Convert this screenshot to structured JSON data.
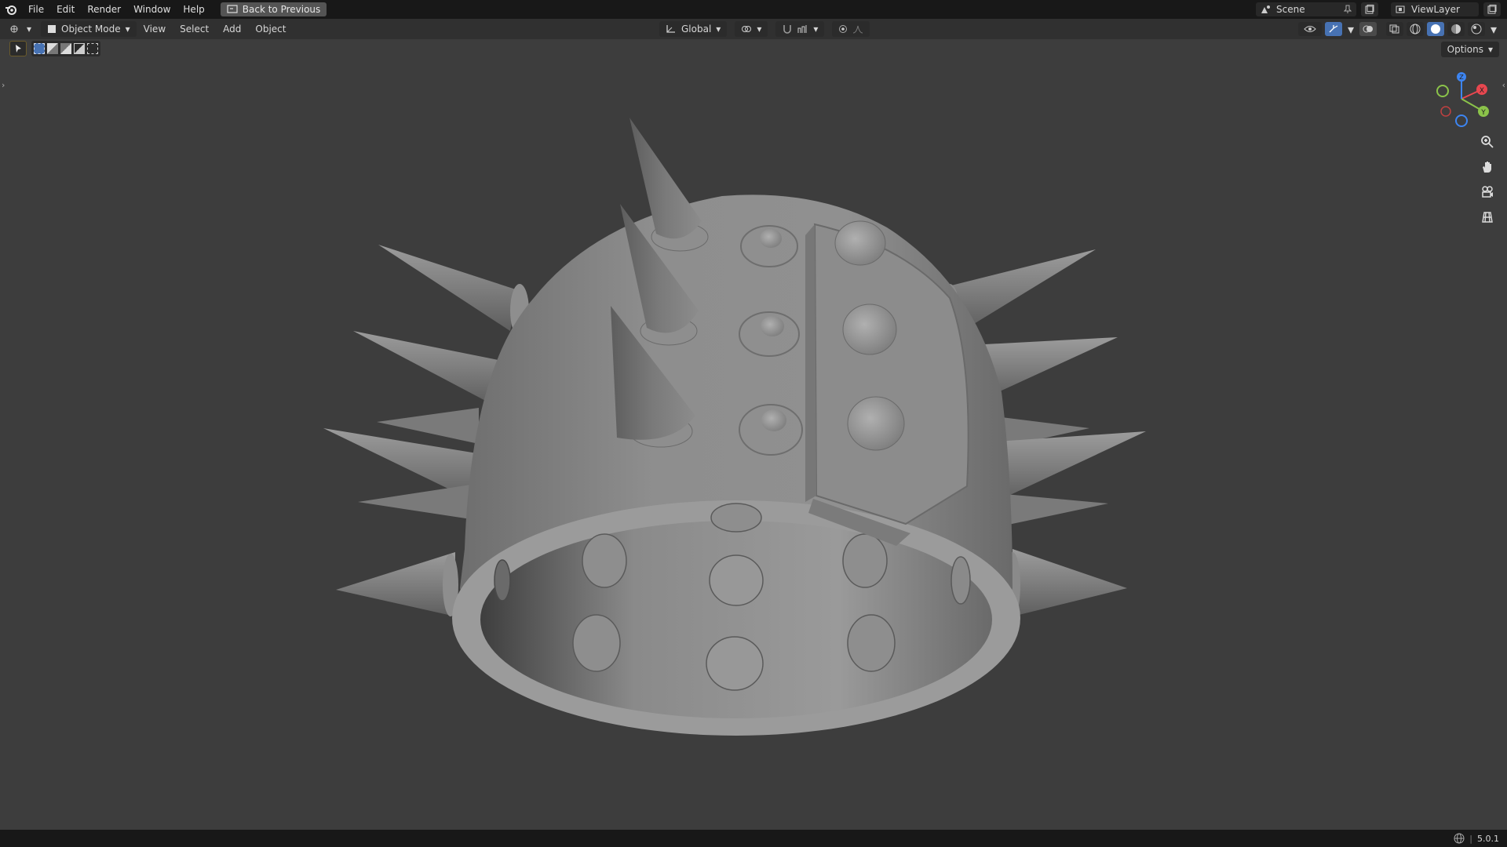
{
  "topbar": {
    "menu": [
      "File",
      "Edit",
      "Render",
      "Window",
      "Help"
    ],
    "back_label": "Back to Previous",
    "scene_name": "Scene",
    "viewlayer_name": "ViewLayer"
  },
  "header": {
    "mode_label": "Object Mode",
    "menus": [
      "View",
      "Select",
      "Add",
      "Object"
    ],
    "transform_orientation": "Global",
    "options_label": "Options"
  },
  "gizmo": {
    "x_label": "X",
    "y_label": "Y",
    "z_label": "Z",
    "x_color": "#e8474f",
    "y_color": "#8bc34a",
    "z_color": "#3d85f2"
  },
  "icons": {
    "app": "blender-logo-icon",
    "back": "back-screen-icon",
    "zoom": "zoom-icon",
    "pan": "pan-hand-icon",
    "camera": "camera-view-icon",
    "ortho": "grid-perspective-icon"
  },
  "status": {
    "version": "5.0.1"
  },
  "colors": {
    "viewport_bg": "#3d3d3d",
    "topbar_bg": "#181818",
    "header_bg": "#303030",
    "accent": "#4772b3"
  }
}
